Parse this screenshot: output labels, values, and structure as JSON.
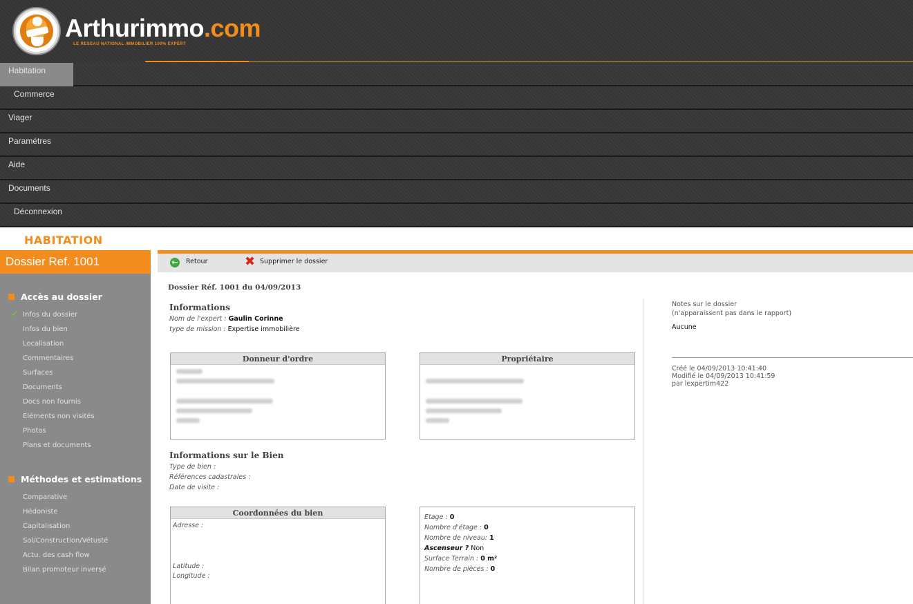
{
  "header": {
    "logo_main": "Arthurimmo",
    "logo_domain": ".com",
    "logo_tagline": "LE RESEAU NATIONAL IMMOBILIER 100% EXPERT"
  },
  "nav": {
    "items": [
      {
        "label": "Habitation",
        "active": true
      },
      {
        "label": "Commerce"
      },
      {
        "label": "Viager"
      },
      {
        "label": "Paramétres"
      },
      {
        "label": "Aide"
      },
      {
        "label": "Documents"
      },
      {
        "label": "Déconnexion"
      }
    ]
  },
  "section_title": "HABITATION",
  "sidebar": {
    "header": "Dossier Ref. 1001",
    "group1": {
      "title": "Accès au dossier",
      "items": [
        "Infos du dossier",
        "Infos du bien",
        "Localisation",
        "Commentaires",
        "Surfaces",
        "Documents",
        "Docs non fournis",
        "Eléments non visités",
        "Photos",
        "Plans et documents"
      ]
    },
    "group2": {
      "title": "Méthodes et estimations",
      "items": [
        "Comparative",
        "Hédoniste",
        "Capitalisation",
        "Sol/Construction/Vétusté",
        "Actu. des cash flow",
        "Bilan promoteur inversé"
      ]
    },
    "check_icon": "✓"
  },
  "toolbar": {
    "back_label": "Retour",
    "delete_label": "Supprimer le dossier",
    "back_icon": "←",
    "delete_icon": "✖"
  },
  "main": {
    "dossier_title": "Dossier Réf. 1001 du  04/09/2013",
    "informations": {
      "title": "Informations",
      "expert_label": "Nom de l'expert :",
      "expert_value": "Gaulin Corinne",
      "mission_label": "type de mission :",
      "mission_value": "Expertise immobilière"
    },
    "donneur_title": "Donneur d'ordre",
    "proprietaire_title": "Propriétaire",
    "bien": {
      "title": "Informations sur le Bien",
      "type_label": "Type de bien :",
      "cadastre_label": "Références cadastrales :",
      "visite_label": "Date de visite :"
    },
    "coord": {
      "title": "Coordonnées du bien",
      "adresse_label": "Adresse :",
      "latitude_label": "Latitude :",
      "longitude_label": "Longitude :"
    },
    "details": {
      "etage_label": "Etage :",
      "etage_value": "0",
      "nb_etage_label": "Nombre d'étage :",
      "nb_etage_value": "0",
      "nb_niveau_label": "Nombre de niveau:",
      "nb_niveau_value": "1",
      "ascenseur_label": "Ascenseur ?",
      "ascenseur_value": "Non",
      "surface_label": "Surface Terrain :",
      "surface_value": "0 m²",
      "pieces_label": "Nombre de pièces :",
      "pieces_value": "0"
    }
  },
  "notes": {
    "title_line1": "Notes sur le dossier",
    "title_line2": "(n'apparaissent pas dans le rapport)",
    "value": "Aucune",
    "created": "Créé le   04/09/2013 10:41:40",
    "modified": "Modifié le   04/09/2013 10:41:59",
    "by": "par lexpertim422"
  }
}
